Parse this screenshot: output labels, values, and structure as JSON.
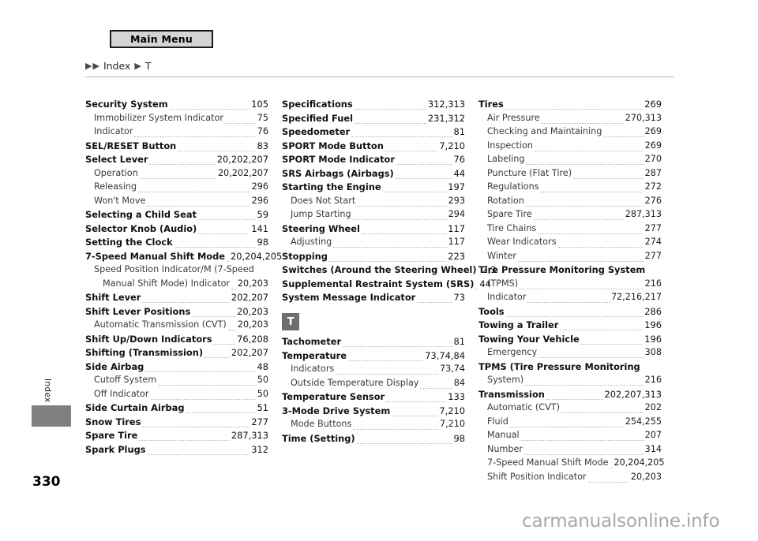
{
  "header": {
    "main_menu_label": "Main Menu",
    "breadcrumb": {
      "arrow_glyph": "▶",
      "item1": "Index",
      "item2": "T"
    }
  },
  "sidebar": {
    "tab_label": "Index",
    "page_number": "330"
  },
  "watermark": "carmanualsonline.info",
  "columns": [
    {
      "entries": [
        {
          "label": "Security System",
          "page": "105",
          "level": 0
        },
        {
          "label": "Immobilizer System Indicator",
          "page": "75",
          "level": 1
        },
        {
          "label": "Indicator",
          "page": "76",
          "level": 1
        },
        {
          "label": "SEL/RESET Button",
          "page": "83",
          "level": 0
        },
        {
          "label": "Select Lever",
          "page": "20,202,207",
          "level": 0
        },
        {
          "label": "Operation",
          "page": "20,202,207",
          "level": 1
        },
        {
          "label": "Releasing",
          "page": "296",
          "level": 1
        },
        {
          "label": "Won't Move",
          "page": "296",
          "level": 1
        },
        {
          "label": "Selecting a Child Seat",
          "page": "59",
          "level": 0
        },
        {
          "label": "Selector Knob (Audio)",
          "page": "141",
          "level": 0
        },
        {
          "label": "Setting the Clock",
          "page": "98",
          "level": 0
        },
        {
          "label": "7-Speed Manual Shift Mode",
          "page": "20,204,205",
          "level": 0
        },
        {
          "label": "Speed Position Indicator/M (7-Speed",
          "page": "",
          "level": 1,
          "wrap": true
        },
        {
          "label": "Manual Shift Mode) Indicator",
          "page": "20,203",
          "level": 2
        },
        {
          "label": "Shift Lever",
          "page": "202,207",
          "level": 0
        },
        {
          "label": "Shift Lever Positions",
          "page": "20,203",
          "level": 0
        },
        {
          "label": "Automatic Transmission (CVT)",
          "page": "20,203",
          "level": 1
        },
        {
          "label": "Shift Up/Down Indicators",
          "page": "76,208",
          "level": 0
        },
        {
          "label": "Shifting (Transmission)",
          "page": "202,207",
          "level": 0
        },
        {
          "label": "Side Airbag",
          "page": "48",
          "level": 0
        },
        {
          "label": "Cutoff System",
          "page": "50",
          "level": 1
        },
        {
          "label": "Off Indicator",
          "page": "50",
          "level": 1
        },
        {
          "label": "Side Curtain Airbag",
          "page": "51",
          "level": 0
        },
        {
          "label": "Snow Tires",
          "page": "277",
          "level": 0
        },
        {
          "label": "Spare Tire",
          "page": "287,313",
          "level": 0
        },
        {
          "label": "Spark Plugs",
          "page": "312",
          "level": 0
        }
      ]
    },
    {
      "entries": [
        {
          "label": "Specifications",
          "page": "312,313",
          "level": 0
        },
        {
          "label": "Specified Fuel",
          "page": "231,312",
          "level": 0
        },
        {
          "label": "Speedometer",
          "page": "81",
          "level": 0
        },
        {
          "label": "SPORT Mode Button",
          "page": "7,210",
          "level": 0
        },
        {
          "label": "SPORT Mode Indicator",
          "page": "76",
          "level": 0
        },
        {
          "label": "SRS Airbags (Airbags)",
          "page": "44",
          "level": 0
        },
        {
          "label": "Starting the Engine",
          "page": "197",
          "level": 0
        },
        {
          "label": "Does Not Start",
          "page": "293",
          "level": 1
        },
        {
          "label": "Jump Starting",
          "page": "294",
          "level": 1
        },
        {
          "label": "Steering Wheel",
          "page": "117",
          "level": 0
        },
        {
          "label": "Adjusting",
          "page": "117",
          "level": 1
        },
        {
          "label": "Stopping",
          "page": "223",
          "level": 0
        },
        {
          "label": "Switches (Around the Steering Wheel)",
          "page": "2,3",
          "level": 0
        },
        {
          "label": "Supplemental Restraint System (SRS)",
          "page": "44",
          "level": 0
        },
        {
          "label": "System Message Indicator",
          "page": "73",
          "level": 0
        }
      ],
      "letter_badge": "T",
      "entries_after_badge": [
        {
          "label": "Tachometer",
          "page": "81",
          "level": 0
        },
        {
          "label": "Temperature",
          "page": "73,74,84",
          "level": 0
        },
        {
          "label": "Indicators",
          "page": "73,74",
          "level": 1
        },
        {
          "label": "Outside Temperature Display",
          "page": "84",
          "level": 1
        },
        {
          "label": "Temperature Sensor",
          "page": "133",
          "level": 0
        },
        {
          "label": "3-Mode Drive System",
          "page": "7,210",
          "level": 0
        },
        {
          "label": "Mode Buttons",
          "page": "7,210",
          "level": 1
        },
        {
          "label": "Time (Setting)",
          "page": "98",
          "level": 0
        }
      ]
    },
    {
      "entries": [
        {
          "label": "Tires",
          "page": "269",
          "level": 0
        },
        {
          "label": "Air Pressure",
          "page": "270,313",
          "level": 1
        },
        {
          "label": "Checking and Maintaining",
          "page": "269",
          "level": 1
        },
        {
          "label": "Inspection",
          "page": "269",
          "level": 1
        },
        {
          "label": "Labeling",
          "page": "270",
          "level": 1
        },
        {
          "label": "Puncture (Flat Tire)",
          "page": "287",
          "level": 1
        },
        {
          "label": "Regulations",
          "page": "272",
          "level": 1
        },
        {
          "label": "Rotation",
          "page": "276",
          "level": 1
        },
        {
          "label": "Spare Tire",
          "page": "287,313",
          "level": 1
        },
        {
          "label": "Tire Chains",
          "page": "277",
          "level": 1
        },
        {
          "label": "Wear Indicators",
          "page": "274",
          "level": 1
        },
        {
          "label": "Winter",
          "page": "277",
          "level": 1
        },
        {
          "label": "Tire Pressure Monitoring System",
          "page": "",
          "level": 0,
          "wrap": true
        },
        {
          "label": "(TPMS)",
          "page": "216",
          "level": 1
        },
        {
          "label": "Indicator",
          "page": "72,216,217",
          "level": 1
        },
        {
          "label": "Tools",
          "page": "286",
          "level": 0
        },
        {
          "label": "Towing a Trailer",
          "page": "196",
          "level": 0
        },
        {
          "label": "Towing Your Vehicle",
          "page": "196",
          "level": 0
        },
        {
          "label": "Emergency",
          "page": "308",
          "level": 1
        },
        {
          "label": "TPMS (Tire Pressure Monitoring",
          "page": "",
          "level": 0,
          "wrap": true
        },
        {
          "label": "System)",
          "page": "216",
          "level": 1
        },
        {
          "label": "Transmission",
          "page": "202,207,313",
          "level": 0
        },
        {
          "label": "Automatic (CVT)",
          "page": "202",
          "level": 1
        },
        {
          "label": "Fluid",
          "page": "254,255",
          "level": 1
        },
        {
          "label": "Manual",
          "page": "207",
          "level": 1
        },
        {
          "label": "Number",
          "page": "314",
          "level": 1
        },
        {
          "label": "7-Speed Manual Shift Mode",
          "page": "20,204,205",
          "level": 1
        },
        {
          "label": "Shift Position Indicator",
          "page": "20,203",
          "level": 1
        }
      ]
    }
  ]
}
